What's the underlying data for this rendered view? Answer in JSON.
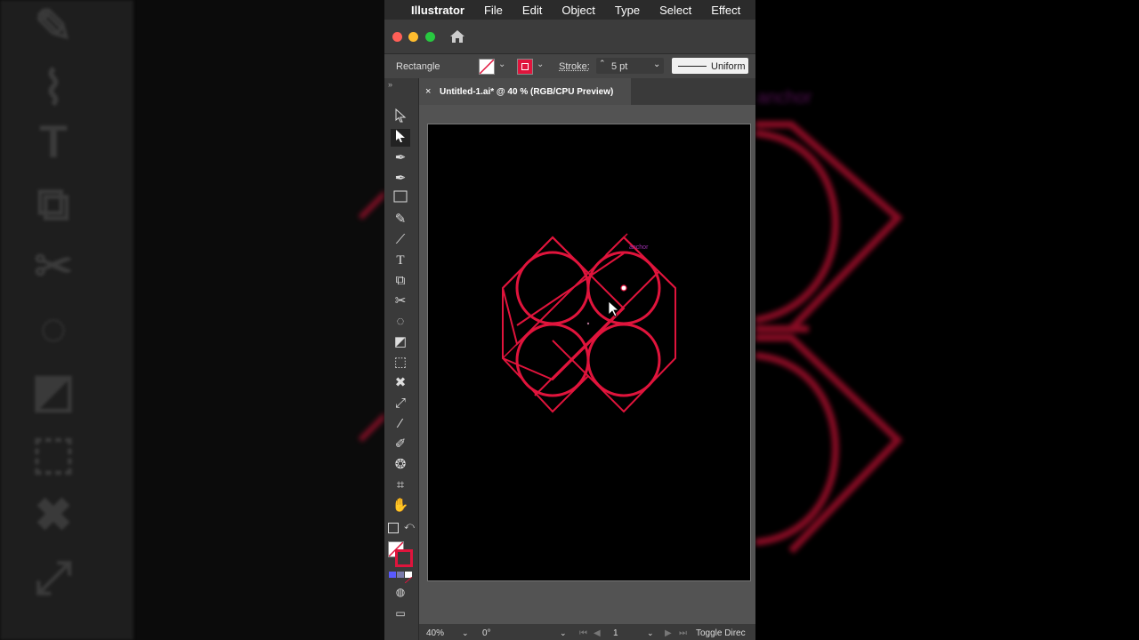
{
  "menubar": {
    "app": "Illustrator",
    "items": [
      "File",
      "Edit",
      "Object",
      "Type",
      "Select",
      "Effect"
    ]
  },
  "control_bar": {
    "object_type": "Rectangle",
    "stroke_label": "Stroke:",
    "stroke_weight": "5 pt",
    "profile": "Uniform"
  },
  "document": {
    "tab_title": "Untitled-1.ai* @ 40 % (RGB/CPU Preview)",
    "close": "×"
  },
  "canvas": {
    "anchor_label": "anchor",
    "stroke_color": "#e0143c",
    "background": "#000000"
  },
  "status": {
    "zoom": "40%",
    "rotation": "0°",
    "artboard_number": "1",
    "current_tool": "Toggle Direc"
  },
  "tools": [
    "selection-tool",
    "direct-selection-tool",
    "pen-tool",
    "curvature-tool",
    "rectangle-tool",
    "pencil-tool",
    "paintbrush-tool",
    "type-tool",
    "scale-tool",
    "scissors-tool",
    "lasso-tool",
    "shape-builder-tool",
    "artboard-tool",
    "puppet-warp-tool",
    "eyedropper-tool",
    "measure-tool",
    "symbol-sprayer-tool",
    "crop-tool",
    "hand-tool"
  ]
}
